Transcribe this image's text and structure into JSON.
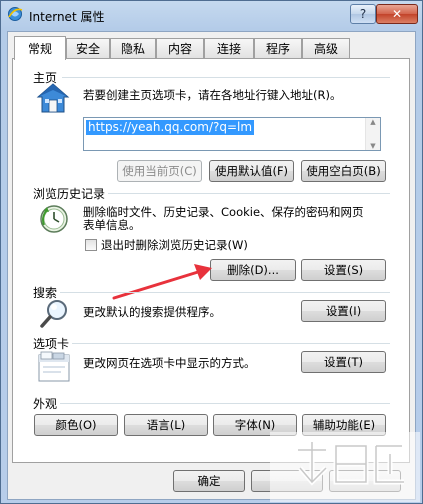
{
  "window": {
    "title": "Internet 属性",
    "help_label": "?",
    "close_label": "✕"
  },
  "tabs": [
    {
      "label": "常规",
      "active": true
    },
    {
      "label": "安全"
    },
    {
      "label": "隐私"
    },
    {
      "label": "内容"
    },
    {
      "label": "连接"
    },
    {
      "label": "程序"
    },
    {
      "label": "高级"
    }
  ],
  "home": {
    "title": "主页",
    "description": "若要创建主页选项卡，请在各地址行键入地址(R)。",
    "url": "https://yeah.qq.com/?q=lm",
    "buttons": {
      "use_current": "使用当前页(C)",
      "use_default": "使用默认值(F)",
      "use_blank": "使用空白页(B)"
    },
    "icon": "house-icon"
  },
  "history": {
    "title": "浏览历史记录",
    "description_line1": "删除临时文件、历史记录、Cookie、保存的密码和网页",
    "description_line2": "表单信息。",
    "checkbox_label": "退出时删除浏览历史记录(W)",
    "checkbox_checked": false,
    "delete_label": "删除(D)...",
    "settings_label": "设置(S)",
    "icon": "history-clock-icon"
  },
  "search": {
    "title": "搜索",
    "description": "更改默认的搜索提供程序。",
    "settings_label": "设置(I)",
    "icon": "magnifier-icon"
  },
  "tabs_section": {
    "title": "选项卡",
    "description": "更改网页在选项卡中显示的方式。",
    "settings_label": "设置(T)",
    "icon": "tabs-window-icon"
  },
  "appearance": {
    "title": "外观",
    "colors_label": "颜色(O)",
    "languages_label": "语言(L)",
    "fonts_label": "字体(N)",
    "accessibility_label": "辅助功能(E)"
  },
  "footer": {
    "ok_label": "确定"
  },
  "annotation_color": "#e8323c"
}
